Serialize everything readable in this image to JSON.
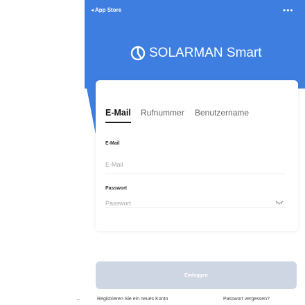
{
  "status_bar": {
    "back_label": "◂ App Store",
    "more_label": "•••"
  },
  "brand": {
    "name": "SOLARMAN Smart"
  },
  "tabs": [
    {
      "label": "E-Mail",
      "active": true
    },
    {
      "label": "Rufnummer",
      "active": false
    },
    {
      "label": "Benutzername",
      "active": false
    }
  ],
  "email_field": {
    "label": "E-Mail",
    "placeholder": "E-Mail",
    "value": ""
  },
  "password_field": {
    "label": "Passwort",
    "placeholder": "Passwort",
    "value": ""
  },
  "login_button": {
    "label": "Einloggen"
  },
  "footer": {
    "dash": "–",
    "register_label": "Registrieren Sie ein neues Konto",
    "forgot_label": "Passwort vergessen?"
  },
  "colors": {
    "header_blue": "#3d7ee0",
    "button_disabled": "#cfd6e3",
    "text_dark": "#111111",
    "placeholder_gray": "#a8a8a8"
  }
}
